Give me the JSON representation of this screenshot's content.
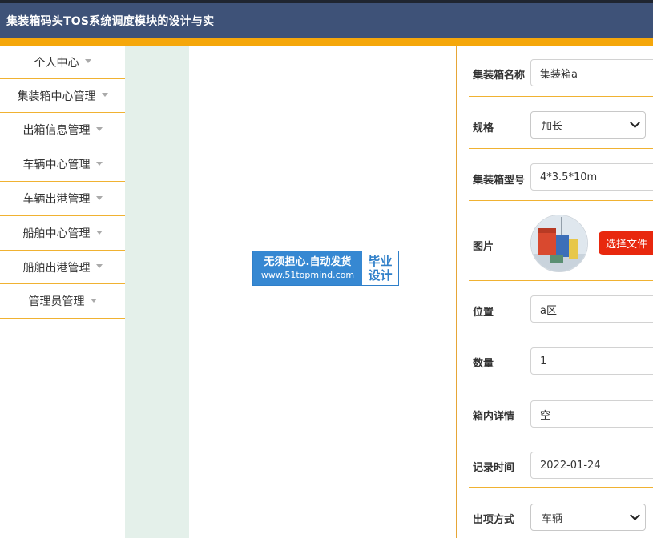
{
  "header": {
    "title": "集装箱码头TOS系统调度模块的设计与实"
  },
  "sidebar": {
    "items": [
      {
        "label": "个人中心"
      },
      {
        "label": "集装箱中心管理"
      },
      {
        "label": "出箱信息管理"
      },
      {
        "label": "车辆中心管理"
      },
      {
        "label": "车辆出港管理"
      },
      {
        "label": "船舶中心管理"
      },
      {
        "label": "船舶出港管理"
      },
      {
        "label": "管理员管理"
      }
    ]
  },
  "watermark": {
    "line1": "无须担心.自动发货",
    "line2": "www.51topmind.com",
    "right1": "毕业",
    "right2": "设计"
  },
  "form": {
    "container_name": {
      "label": "集装箱名称",
      "value": "集装箱a"
    },
    "spec": {
      "label": "规格",
      "value": "加长"
    },
    "model": {
      "label": "集装箱型号",
      "value": "4*3.5*10m"
    },
    "image": {
      "label": "图片",
      "button": "选择文件"
    },
    "location": {
      "label": "位置",
      "value": "a区"
    },
    "quantity": {
      "label": "数量",
      "value": "1"
    },
    "contents": {
      "label": "箱内详情",
      "value": "空"
    },
    "record_time": {
      "label": "记录时间",
      "value": "2022-01-24"
    },
    "exit_method": {
      "label": "出项方式",
      "value": "车辆"
    }
  },
  "colors": {
    "header_bg": "#3e5278",
    "accent": "#f5a70b",
    "divider": "#f0b232",
    "strip": "#e4f0ea",
    "button": "#e8280e"
  }
}
